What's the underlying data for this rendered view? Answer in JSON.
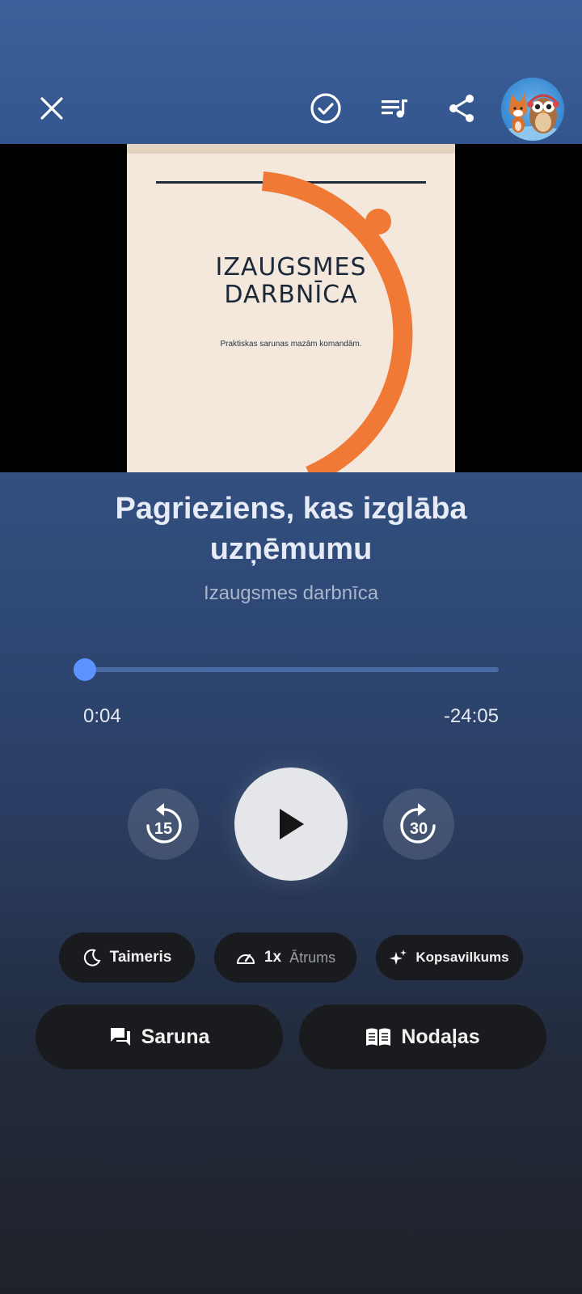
{
  "header": {
    "close_icon": "close-icon",
    "done_icon": "check-circle-icon",
    "queue_icon": "playlist-icon",
    "share_icon": "share-icon",
    "avatar": "fox-and-owl-avatar"
  },
  "cover": {
    "title_line1": "IZAUGSMES",
    "title_line2": "DARBNĪCA",
    "subtitle": "Praktiskas sarunas mazām komandām.",
    "accent_color": "#f07a35",
    "background_color": "#f4e7dc"
  },
  "track": {
    "title": "Pagrieziens, kas izglāba uzņēmumu",
    "author": "Izaugsmes darbnīca"
  },
  "player": {
    "elapsed": "0:04",
    "remaining": "-24:05",
    "progress_fraction": 0.003,
    "rewind_seconds": "15",
    "forward_seconds": "30",
    "accent_color": "#5b93ff"
  },
  "options": {
    "timer_label": "Taimeris",
    "speed_value": "1x",
    "speed_label": "Ātrums",
    "summary_label": "Kopsavilkums"
  },
  "actions": {
    "chat_label": "Saruna",
    "chapters_label": "Nodaļas"
  }
}
